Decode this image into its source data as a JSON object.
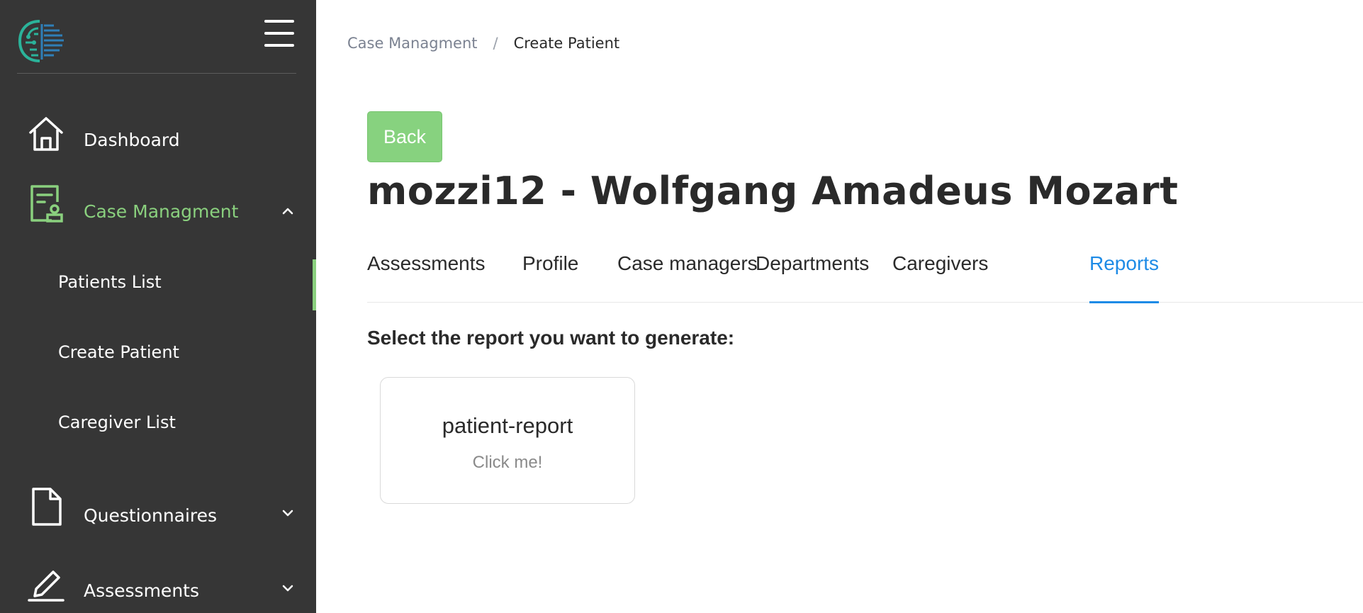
{
  "colors": {
    "sidebar_bg": "#363636",
    "accent_green": "#8ad07e",
    "button_green": "#87d27f",
    "tab_active_blue": "#1e8be6",
    "text_dark": "#2a2a2a"
  },
  "sidebar": {
    "logo_icon": "brain-logo-icon",
    "menu_icon": "hamburger-menu-icon",
    "items": [
      {
        "label": "Dashboard",
        "icon": "home-icon"
      },
      {
        "label": "Case Managment",
        "icon": "case-document-icon",
        "expanded": true
      },
      {
        "label": "Questionnaires",
        "icon": "file-icon",
        "expanded": false
      },
      {
        "label": "Assessments",
        "icon": "pencil-icon",
        "expanded": false
      }
    ],
    "sub_items": [
      {
        "label": "Patients List"
      },
      {
        "label": "Create Patient"
      },
      {
        "label": "Caregiver List"
      }
    ]
  },
  "breadcrumb": {
    "parent": "Case Managment",
    "separator": "/",
    "current": "Create Patient"
  },
  "main": {
    "back_label": "Back",
    "title": "mozzi12 - Wolfgang Amadeus Mozart",
    "tabs": [
      {
        "label": "Assessments"
      },
      {
        "label": "Profile"
      },
      {
        "label": "Case managers"
      },
      {
        "label": "Departments"
      },
      {
        "label": "Caregivers"
      },
      {
        "label": "Reports",
        "active": true
      }
    ],
    "section_heading": "Select the report you want to generate:",
    "report_card": {
      "title": "patient-report",
      "subtitle": "Click me!"
    }
  }
}
